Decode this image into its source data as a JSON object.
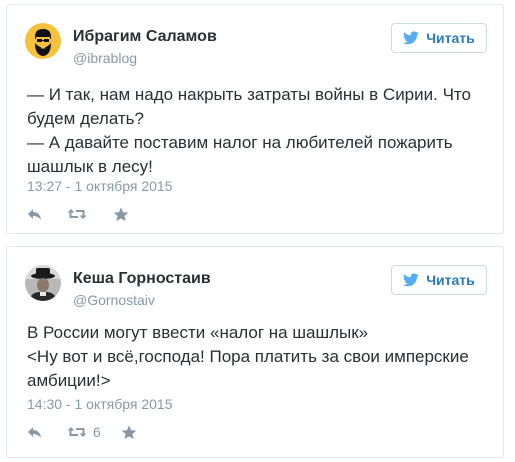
{
  "tweets": [
    {
      "author_name": "Ибрагим Саламов",
      "handle": "@ibrablog",
      "follow_label": "Читать",
      "text_lines": [
        "— И так, нам надо накрыть затраты войны в Сирии. Что",
        "будем делать?",
        "— А давайте поставим налог на любителей пожарить",
        "шашлык в лесу!"
      ],
      "timestamp": "13:27 - 1 октября 2015",
      "retweet_count": ""
    },
    {
      "author_name": "Кеша Горностаив",
      "handle": "@Gornostaiv",
      "follow_label": "Читать",
      "text_lines": [
        "В России могут ввести «налог на шашлык»",
        "<Ну вот и всё,господа! Пора платить за свои имперские",
        "амбиции!>"
      ],
      "timestamp": "14:30 - 1 октября 2015",
      "retweet_count": "6"
    }
  ],
  "colors": {
    "twitter_blue": "#2b7bb9",
    "bird_blue": "#55acee",
    "muted_gray": "#8899a6",
    "border": "#e1e8ed",
    "text": "#292f33"
  },
  "icons": {
    "reply": "reply-icon",
    "retweet": "retweet-icon",
    "favorite": "star-icon",
    "bird": "twitter-bird-icon"
  }
}
